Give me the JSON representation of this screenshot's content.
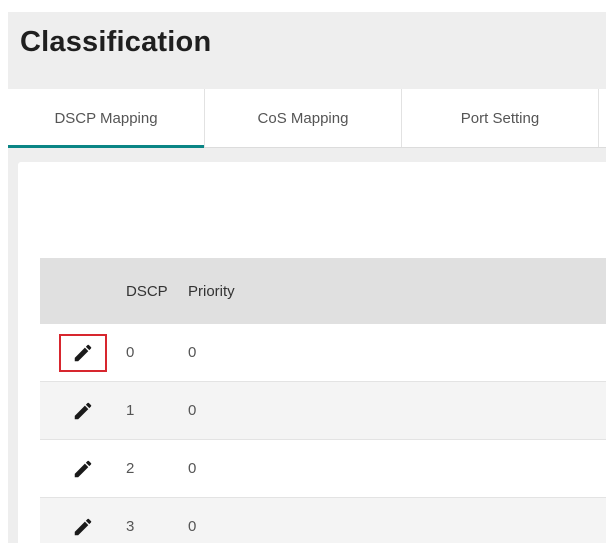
{
  "page": {
    "title": "Classification"
  },
  "tabs": [
    {
      "label": "DSCP Mapping",
      "active": true
    },
    {
      "label": "CoS Mapping",
      "active": false
    },
    {
      "label": "Port Setting",
      "active": false
    }
  ],
  "table": {
    "columns": [
      "",
      "DSCP",
      "Priority"
    ],
    "rows": [
      {
        "dscp": "0",
        "priority": "0",
        "edit_icon": "pencil-icon",
        "highlighted": true
      },
      {
        "dscp": "1",
        "priority": "0",
        "edit_icon": "pencil-icon",
        "highlighted": false
      },
      {
        "dscp": "2",
        "priority": "0",
        "edit_icon": "pencil-icon",
        "highlighted": false
      },
      {
        "dscp": "3",
        "priority": "0",
        "edit_icon": "pencil-icon",
        "highlighted": false
      }
    ]
  },
  "colors": {
    "active_tab_indicator": "#0a8585",
    "highlight_border": "#d7262e",
    "header_bg": "#e0e0e0",
    "page_bg": "#eeeeee"
  }
}
